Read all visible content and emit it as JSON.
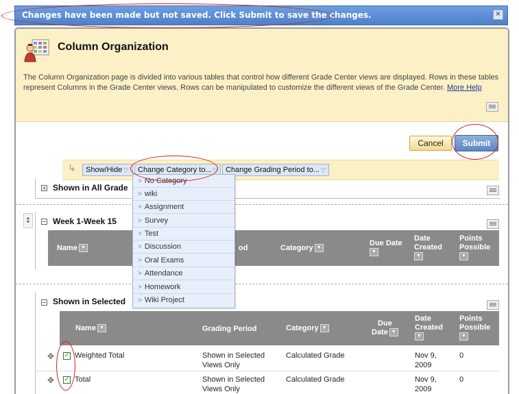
{
  "banner": {
    "message": "Changes have been made but not saved. Click Submit to save the changes.",
    "close": "×"
  },
  "header": {
    "title": "Column Organization",
    "description": "The Column Organization page is divided into various tables that control how different Grade Center views are displayed. Rows in these tables represent Columns in the Grade Center views. Rows can be manipulated to customize the different views of the Grade Center.",
    "more_help": "More Help"
  },
  "buttons": {
    "cancel": "Cancel",
    "submit": "Submit"
  },
  "action_bar": {
    "show_hide": "Show/Hide",
    "change_category": "Change Category to...",
    "change_grading_period": "Change Grading Period to..."
  },
  "dropdown": {
    "items": [
      "No Category",
      "wiki",
      "Assignment",
      "Survey",
      "Test",
      "Discussion",
      "Oral Exams",
      "Attendance",
      "Homework",
      "Wiki Project"
    ]
  },
  "sections": {
    "all": {
      "title": "Shown in All Grade"
    },
    "week": {
      "title": "Week 1-Week 15",
      "columns": {
        "name": "Name",
        "grading_period": "od",
        "category": "Category",
        "due_date": "Due Date",
        "date_created_1": "Date",
        "date_created_2": "Created",
        "points_1": "Points",
        "points_2": "Possible"
      }
    },
    "selected": {
      "title": "Shown in Selected",
      "columns": {
        "name": "Name",
        "grading_period": "Grading Period",
        "category": "Category",
        "due_date_1": "Due",
        "due_date_2": "Date",
        "date_created_1": "Date",
        "date_created_2": "Created",
        "points_1": "Points",
        "points_2": "Possible"
      },
      "rows": [
        {
          "name": "Weighted Total",
          "period_1": "Shown in Selected",
          "period_2": "Views Only",
          "category": "Calculated Grade",
          "date_1": "Nov 9,",
          "date_2": "2009",
          "points": "0"
        },
        {
          "name": "Total",
          "period_1": "Shown in Selected",
          "period_2": "Views Only",
          "category": "Calculated Grade",
          "date_1": "Nov 9,",
          "date_2": "2009",
          "points": "0"
        }
      ]
    }
  }
}
